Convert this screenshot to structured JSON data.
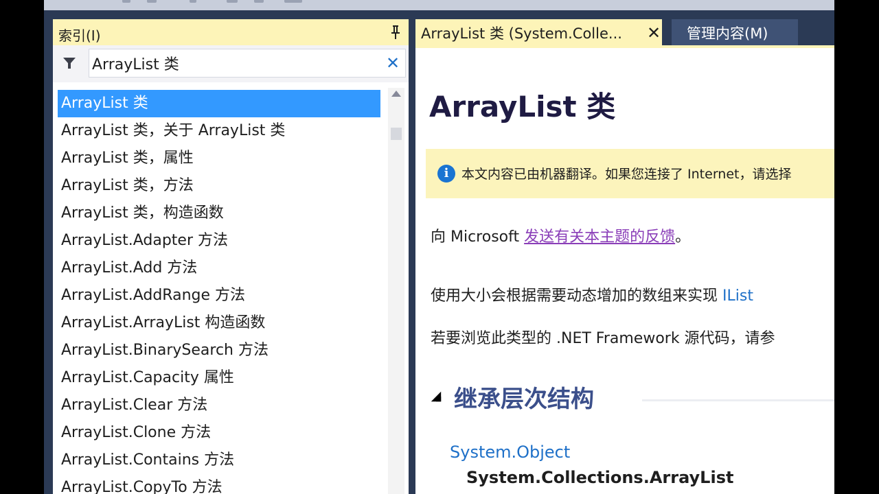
{
  "index_panel": {
    "title": "索引(I)",
    "search_value": "ArrayList 类",
    "clear_glyph": "✕",
    "items": [
      "ArrayList 类",
      "ArrayList 类，关于 ArrayList 类",
      "ArrayList 类，属性",
      "ArrayList 类，方法",
      "ArrayList 类，构造函数",
      "ArrayList.Adapter 方法",
      "ArrayList.Add 方法",
      "ArrayList.AddRange 方法",
      "ArrayList.ArrayList 构造函数",
      "ArrayList.BinarySearch 方法",
      "ArrayList.Capacity 属性",
      "ArrayList.Clear 方法",
      "ArrayList.Clone 方法",
      "ArrayList.Contains 方法",
      "ArrayList.CopyTo 方法"
    ],
    "selected_index": 0
  },
  "tabs": {
    "active_label": "ArrayList 类 (System.Colle...",
    "close_glyph": "✕",
    "second_label": "管理内容(M)"
  },
  "doc": {
    "title": "ArrayList 类",
    "notice_icon": "i",
    "notice_text": "本文内容已由机器翻译。如果您连接了 Internet，请选择",
    "feedback_prefix": "向  Microsoft ",
    "feedback_link": "发送有关本主题的反馈",
    "feedback_suffix": "。",
    "desc_text": "使用大小会根据需要动态增加的数组来实现 ",
    "desc_link": "IList",
    "source_text": "若要浏览此类型的 .NET Framework 源代码，请参",
    "section_title": "继承层次结构",
    "hierarchy_parent": "System.Object",
    "hierarchy_child": "System.Collections.ArrayList"
  },
  "icons": {
    "pin": "pin-icon",
    "filter": "filter-icon",
    "info": "info-icon",
    "clear": "close-icon"
  },
  "colors": {
    "selection": "#3399ff",
    "tab_active": "#fdf4b8",
    "link": "#1e70c8",
    "visited_link": "#8a3eb8",
    "notice_bg": "#fcf4bc"
  }
}
